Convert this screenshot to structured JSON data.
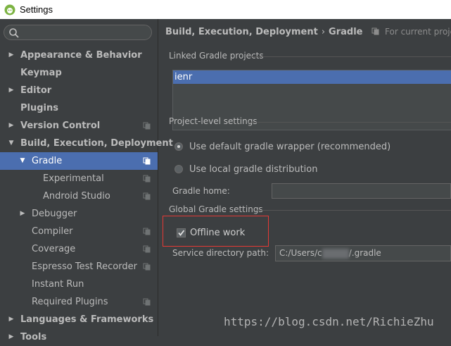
{
  "window": {
    "title": "Settings",
    "icon": "android-icon"
  },
  "search": {
    "placeholder": "",
    "icon": "search-icon"
  },
  "sidebar": {
    "items": [
      {
        "label": "Appearance & Behavior",
        "level": 0,
        "arrow": "right",
        "bold": true
      },
      {
        "label": "Keymap",
        "level": 0,
        "arrow": "",
        "bold": true
      },
      {
        "label": "Editor",
        "level": 0,
        "arrow": "right",
        "bold": true
      },
      {
        "label": "Plugins",
        "level": 0,
        "arrow": "",
        "bold": true
      },
      {
        "label": "Version Control",
        "level": 0,
        "arrow": "right",
        "bold": true,
        "copy": true
      },
      {
        "label": "Build, Execution, Deployment",
        "level": 0,
        "arrow": "down",
        "bold": true
      },
      {
        "label": "Gradle",
        "level": 1,
        "arrow": "down",
        "selected": true,
        "copy": true
      },
      {
        "label": "Experimental",
        "level": 2,
        "arrow": "",
        "copy": true
      },
      {
        "label": "Android Studio",
        "level": 2,
        "arrow": "",
        "copy": true
      },
      {
        "label": "Debugger",
        "level": 1,
        "arrow": "right"
      },
      {
        "label": "Compiler",
        "level": 1,
        "arrow": "",
        "copy": true
      },
      {
        "label": "Coverage",
        "level": 1,
        "arrow": "",
        "copy": true
      },
      {
        "label": "Espresso Test Recorder",
        "level": 1,
        "arrow": "",
        "copy": true
      },
      {
        "label": "Instant Run",
        "level": 1,
        "arrow": ""
      },
      {
        "label": "Required Plugins",
        "level": 1,
        "arrow": "",
        "copy": true
      },
      {
        "label": "Languages & Frameworks",
        "level": 0,
        "arrow": "right",
        "bold": true
      },
      {
        "label": "Tools",
        "level": 0,
        "arrow": "right",
        "bold": true
      }
    ]
  },
  "breadcrumb": {
    "parent": "Build, Execution, Deployment",
    "separator": "›",
    "current": "Gradle",
    "note": "For current project"
  },
  "linked": {
    "label": "Linked Gradle projects",
    "projects": [
      "ienr"
    ]
  },
  "project_level": {
    "label": "Project-level settings",
    "option_wrapper": "Use default gradle wrapper (recommended)",
    "option_local": "Use local gradle distribution",
    "selected": "wrapper",
    "gradle_home_label": "Gradle home:",
    "gradle_home_value": ""
  },
  "global": {
    "label": "Global Gradle settings",
    "offline_label": "Offline work",
    "offline_checked": true,
    "service_dir_label": "Service directory path:",
    "service_dir_prefix": "C:/Users/c",
    "service_dir_suffix": "/.gradle"
  },
  "watermark": "https://blog.csdn.net/RichieZhu",
  "colors": {
    "background": "#3c3f41",
    "selection": "#4b6eaf",
    "highlight": "#e53935"
  }
}
